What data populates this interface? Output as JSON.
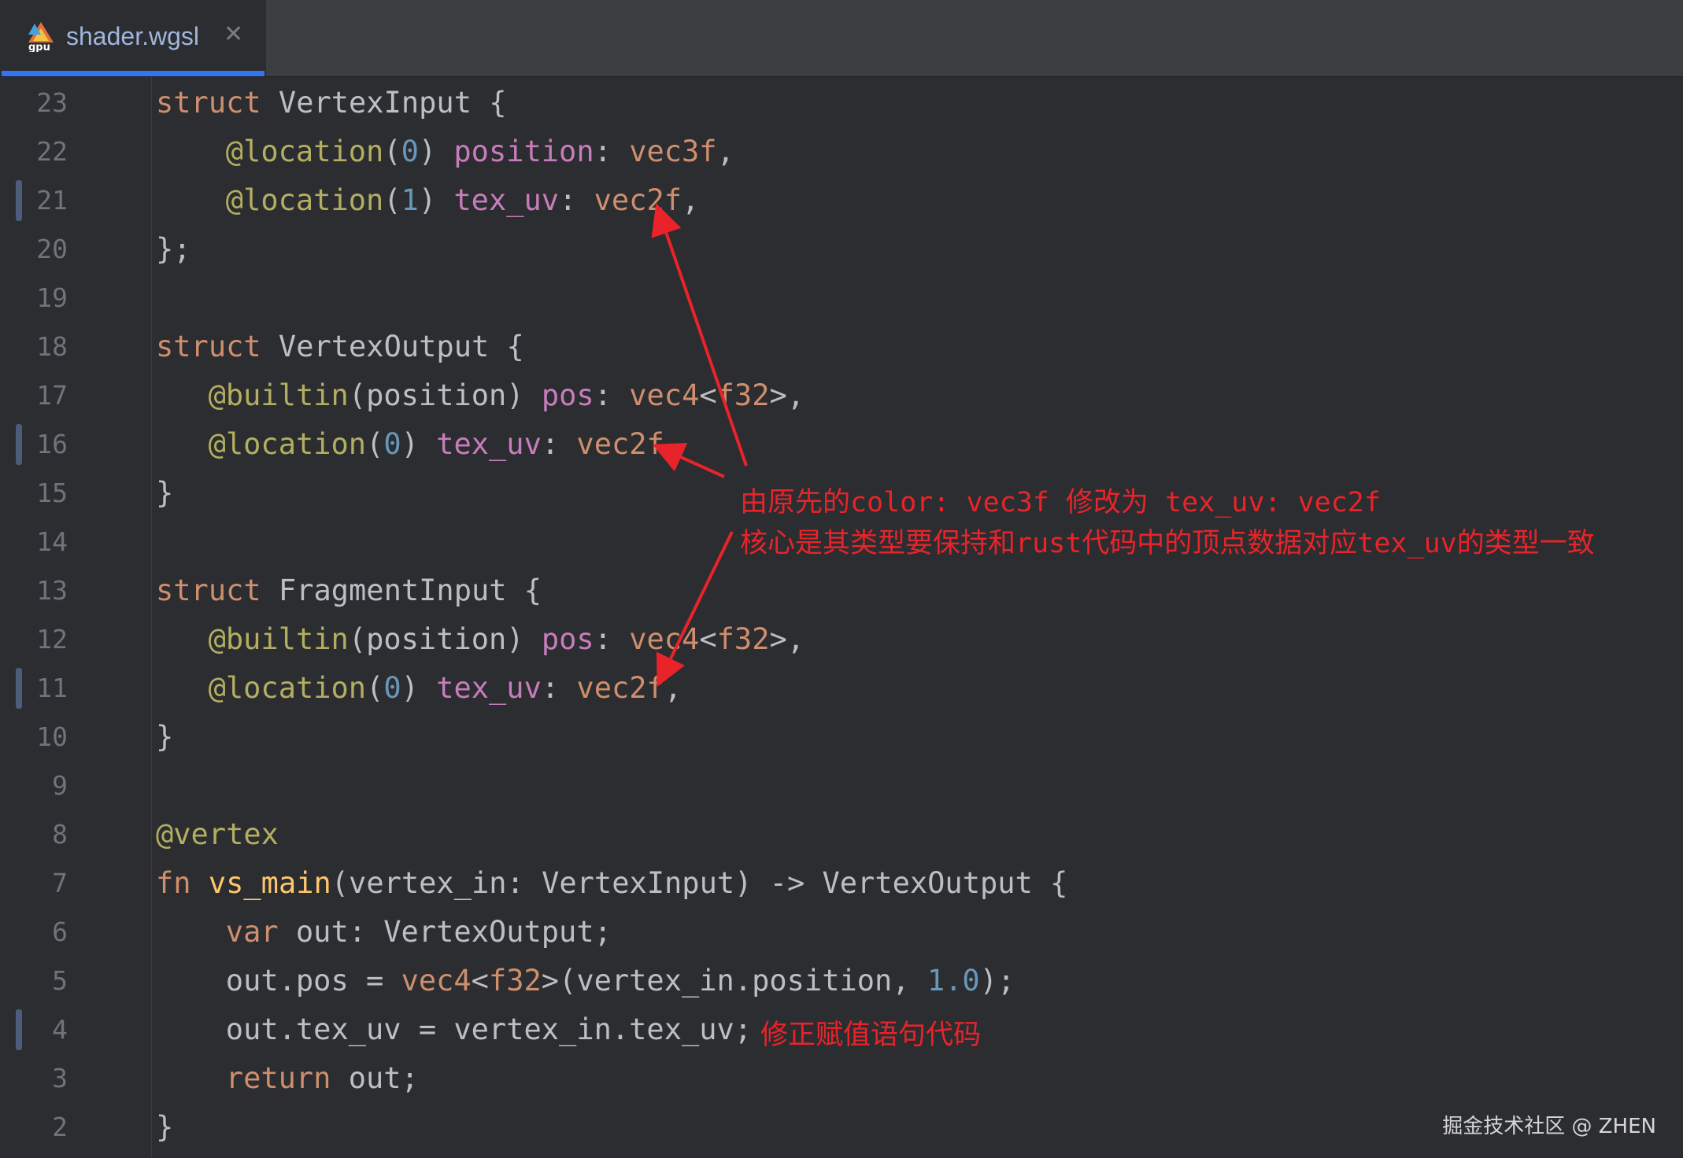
{
  "tab": {
    "filename": "shader.wgsl",
    "icon": "wgpu-logo-icon",
    "icon_text": "gpu",
    "close_glyph": "✕"
  },
  "code_lines": [
    {
      "num": "23",
      "indent": 0,
      "mark": false,
      "tokens": [
        [
          "kw",
          "struct"
        ],
        [
          "plain",
          " VertexInput {"
        ]
      ]
    },
    {
      "num": "22",
      "indent": 4,
      "mark": false,
      "tokens": [
        [
          "at",
          "@location"
        ],
        [
          "plain",
          "("
        ],
        [
          "num",
          "0"
        ],
        [
          "plain",
          ") "
        ],
        [
          "prop",
          "position"
        ],
        [
          "plain",
          ": "
        ],
        [
          "ty",
          "vec3f"
        ],
        [
          "plain",
          ","
        ]
      ]
    },
    {
      "num": "21",
      "indent": 4,
      "mark": true,
      "tokens": [
        [
          "at",
          "@location"
        ],
        [
          "plain",
          "("
        ],
        [
          "num",
          "1"
        ],
        [
          "plain",
          ") "
        ],
        [
          "prop",
          "tex_uv"
        ],
        [
          "plain",
          ": "
        ],
        [
          "ty",
          "vec2f"
        ],
        [
          "plain",
          ","
        ]
      ]
    },
    {
      "num": "20",
      "indent": 0,
      "mark": false,
      "tokens": [
        [
          "plain",
          "};"
        ]
      ]
    },
    {
      "num": "19",
      "indent": 0,
      "mark": false,
      "tokens": []
    },
    {
      "num": "18",
      "indent": 0,
      "mark": false,
      "tokens": [
        [
          "kw",
          "struct"
        ],
        [
          "plain",
          " VertexOutput {"
        ]
      ]
    },
    {
      "num": "17",
      "indent": 3,
      "mark": false,
      "tokens": [
        [
          "at",
          "@builtin"
        ],
        [
          "plain",
          "(position) "
        ],
        [
          "prop",
          "pos"
        ],
        [
          "plain",
          ": "
        ],
        [
          "ty",
          "vec4"
        ],
        [
          "plain",
          "<"
        ],
        [
          "ty",
          "f32"
        ],
        [
          "plain",
          ">,"
        ]
      ]
    },
    {
      "num": "16",
      "indent": 3,
      "mark": true,
      "tokens": [
        [
          "at",
          "@location"
        ],
        [
          "plain",
          "("
        ],
        [
          "num",
          "0"
        ],
        [
          "plain",
          ") "
        ],
        [
          "prop",
          "tex_uv"
        ],
        [
          "plain",
          ": "
        ],
        [
          "ty",
          "vec2f"
        ],
        [
          "plain",
          ","
        ]
      ]
    },
    {
      "num": "15",
      "indent": 0,
      "mark": false,
      "tokens": [
        [
          "plain",
          "}"
        ]
      ]
    },
    {
      "num": "14",
      "indent": 0,
      "mark": false,
      "tokens": []
    },
    {
      "num": "13",
      "indent": 0,
      "mark": false,
      "tokens": [
        [
          "kw",
          "struct"
        ],
        [
          "plain",
          " FragmentInput {"
        ]
      ]
    },
    {
      "num": "12",
      "indent": 3,
      "mark": false,
      "tokens": [
        [
          "at",
          "@builtin"
        ],
        [
          "plain",
          "(position) "
        ],
        [
          "prop",
          "pos"
        ],
        [
          "plain",
          ": "
        ],
        [
          "ty",
          "vec4"
        ],
        [
          "plain",
          "<"
        ],
        [
          "ty",
          "f32"
        ],
        [
          "plain",
          ">,"
        ]
      ]
    },
    {
      "num": "11",
      "indent": 3,
      "mark": true,
      "tokens": [
        [
          "at",
          "@location"
        ],
        [
          "plain",
          "("
        ],
        [
          "num",
          "0"
        ],
        [
          "plain",
          ") "
        ],
        [
          "prop",
          "tex_uv"
        ],
        [
          "plain",
          ": "
        ],
        [
          "ty",
          "vec2f"
        ],
        [
          "plain",
          ","
        ]
      ]
    },
    {
      "num": "10",
      "indent": 0,
      "mark": false,
      "tokens": [
        [
          "plain",
          "}"
        ]
      ]
    },
    {
      "num": "9",
      "indent": 0,
      "mark": false,
      "tokens": []
    },
    {
      "num": "8",
      "indent": 0,
      "mark": false,
      "tokens": [
        [
          "at",
          "@vertex"
        ]
      ]
    },
    {
      "num": "7",
      "indent": 0,
      "mark": false,
      "tokens": [
        [
          "kw",
          "fn"
        ],
        [
          "plain",
          " "
        ],
        [
          "fn",
          "vs_main"
        ],
        [
          "plain",
          "(vertex_in: VertexInput) -> VertexOutput {"
        ]
      ]
    },
    {
      "num": "6",
      "indent": 4,
      "mark": false,
      "tokens": [
        [
          "kw",
          "var"
        ],
        [
          "plain",
          " out: VertexOutput;"
        ]
      ]
    },
    {
      "num": "5",
      "indent": 4,
      "mark": false,
      "tokens": [
        [
          "plain",
          "out.pos = "
        ],
        [
          "ty",
          "vec4"
        ],
        [
          "plain",
          "<"
        ],
        [
          "ty",
          "f32"
        ],
        [
          "plain",
          ">(vertex_in.position, "
        ],
        [
          "num",
          "1.0"
        ],
        [
          "plain",
          ");"
        ]
      ]
    },
    {
      "num": "4",
      "indent": 4,
      "mark": true,
      "tokens": [
        [
          "plain",
          "out.tex_uv = vertex_in.tex_uv;"
        ]
      ]
    },
    {
      "num": "3",
      "indent": 4,
      "mark": false,
      "tokens": [
        [
          "kw",
          "return"
        ],
        [
          "plain",
          " out;"
        ]
      ]
    },
    {
      "num": "2",
      "indent": 0,
      "mark": false,
      "tokens": [
        [
          "plain",
          "}"
        ]
      ]
    }
  ],
  "annotations": {
    "note_line1": "由原先的color: vec3f 修改为 tex_uv: vec2f",
    "note_line2": "核心是其类型要保持和rust代码中的顶点数据对应tex_uv的类型一致",
    "fix_note": "修正赋值语句代码",
    "color": "#e8242a"
  },
  "watermark": "掘金技术社区 @ ZHEN",
  "colors": {
    "background": "#2b2d30",
    "keyword": "#cf8e6d",
    "annotation": "#b3ae60",
    "property": "#c77dbb",
    "number": "#6897bb",
    "function": "#ffc66d",
    "tab_accent": "#3574f0"
  }
}
